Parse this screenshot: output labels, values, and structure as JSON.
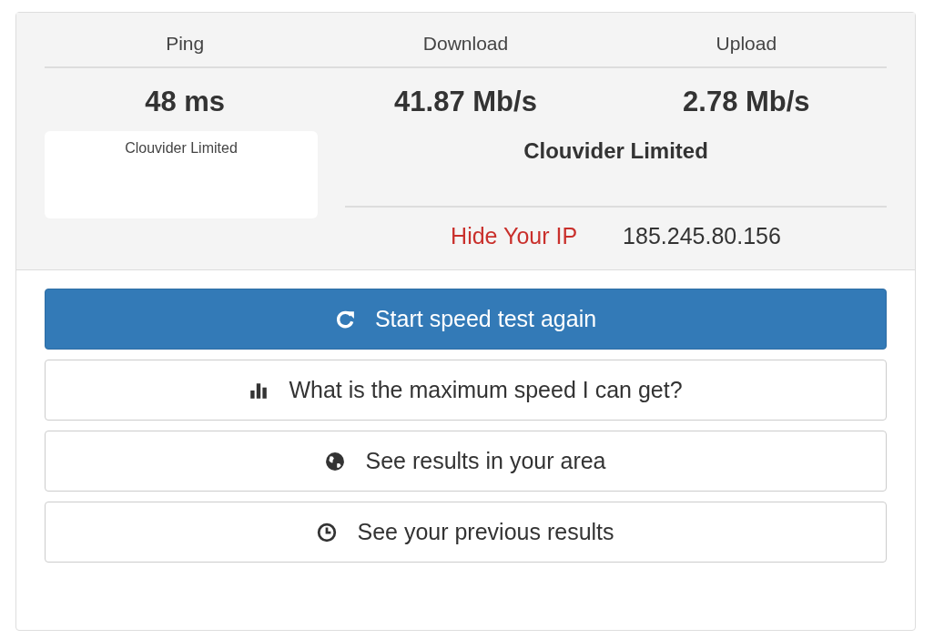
{
  "metrics": [
    {
      "label": "Ping",
      "value": "48 ms"
    },
    {
      "label": "Download",
      "value": "41.87 Mb/s"
    },
    {
      "label": "Upload",
      "value": "2.78 Mb/s"
    }
  ],
  "server_box": {
    "text": "Clouvider Limited"
  },
  "provider": "Clouvider Limited",
  "ip_row": {
    "link": "Hide Your IP",
    "address": "185.245.80.156"
  },
  "buttons": [
    {
      "label": "Start speed test again",
      "primary": true
    },
    {
      "label": "What is the maximum speed I can get?",
      "primary": false
    },
    {
      "label": "See results in your area",
      "primary": false
    },
    {
      "label": "See your previous results",
      "primary": false
    }
  ]
}
